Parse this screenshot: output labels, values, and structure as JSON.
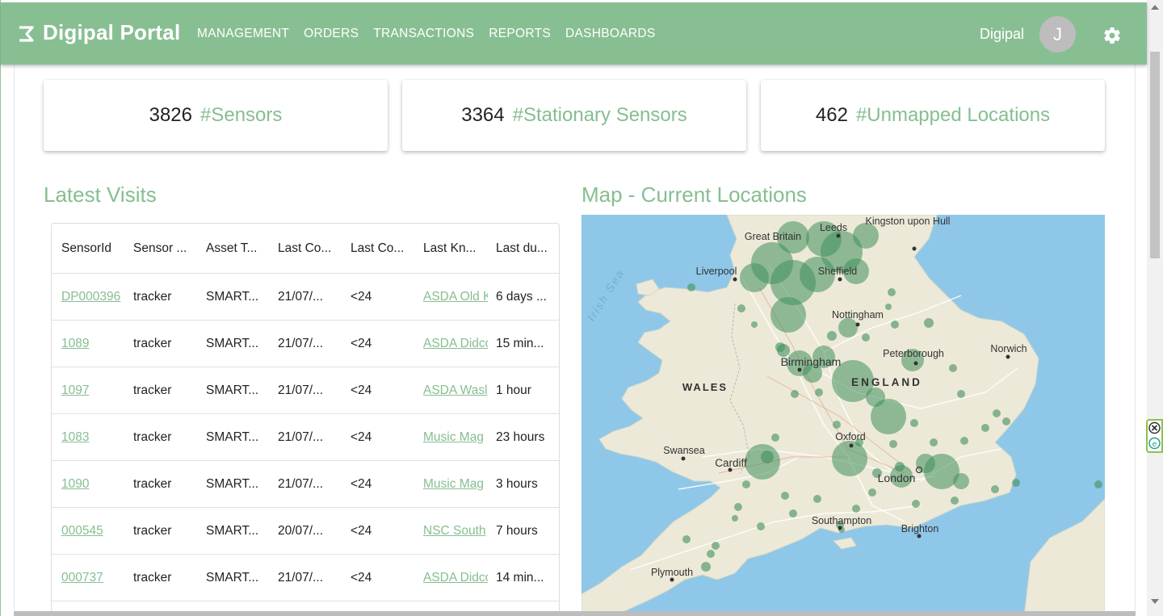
{
  "header": {
    "brand": "Digipal Portal",
    "nav": [
      "MANAGEMENT",
      "ORDERS",
      "TRANSACTIONS",
      "REPORTS",
      "DASHBOARDS"
    ],
    "user_name": "Digipal",
    "avatar_initial": "J",
    "settings_icon": "gear-icon",
    "colors": {
      "bar": "#88bf92",
      "accent": "#86be90"
    }
  },
  "stats": [
    {
      "value": "3826",
      "label": "#Sensors"
    },
    {
      "value": "3364",
      "label": "#Stationary Sensors"
    },
    {
      "value": "462",
      "label": "#Unmapped Locations"
    }
  ],
  "latest_visits": {
    "title": "Latest Visits",
    "columns": [
      "SensorId",
      "Sensor ...",
      "Asset T...",
      "Last Co...",
      "Last Co...",
      "Last Kn...",
      "Last du..."
    ],
    "rows": [
      [
        "DP000396",
        "tracker",
        "SMART...",
        "21/07/...",
        "<24",
        "ASDA Old K",
        "6 days ..."
      ],
      [
        "1089",
        "tracker",
        "SMART...",
        "21/07/...",
        "<24",
        "ASDA Didco",
        "15 min..."
      ],
      [
        "1097",
        "tracker",
        "SMART...",
        "21/07/...",
        "<24",
        "ASDA Wasl",
        "1 hour"
      ],
      [
        "1083",
        "tracker",
        "SMART...",
        "21/07/...",
        "<24",
        "Music Mag",
        "23 hours"
      ],
      [
        "1090",
        "tracker",
        "SMART...",
        "21/07/...",
        "<24",
        "Music Mag",
        "3 hours"
      ],
      [
        "000545",
        "tracker",
        "SMART...",
        "20/07/...",
        "<24",
        "NSC South",
        "7 hours"
      ],
      [
        "000737",
        "tracker",
        "SMART...",
        "21/07/...",
        "<24",
        "ASDA Didco",
        "14 min..."
      ]
    ]
  },
  "map": {
    "title": "Map - Current Locations",
    "places": [
      "Kingston upon Hull",
      "Leeds",
      "Great Britain",
      "Liverpool",
      "Sheffield",
      "Irish Sea",
      "Nottingham",
      "Peterborough",
      "Norwich",
      "Birmingham",
      "ENGLAND",
      "WALES",
      "Oxford",
      "Swansea",
      "Cardiff",
      "London",
      "Southampton",
      "Brighton",
      "Plymouth"
    ],
    "colors": {
      "sea": "#8fc7e8",
      "land": "#ede9d8",
      "marker": "#3f8f5c"
    }
  }
}
